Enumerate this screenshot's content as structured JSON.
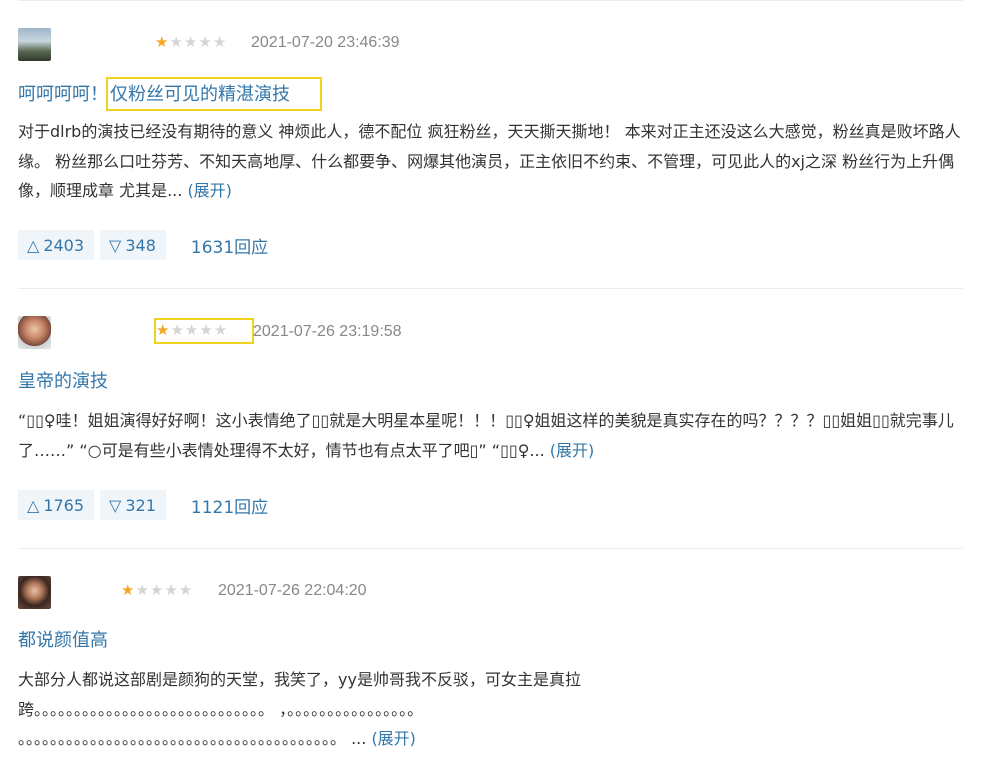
{
  "reviews": [
    {
      "rating": 1,
      "date": "2021-07-20 23:46:39",
      "title_plain": "呵呵呵呵！",
      "title_highlight": "仅粉丝可见的精湛演技",
      "body": "对于dlrb的演技已经没有期待的意义 神烦此人，德不配位 疯狂粉丝，天天撕天撕地！ 本来对正主还没这么大感觉，粉丝真是败坏路人缘。 粉丝那么口吐芬芳、不知天高地厚、什么都要争、网爆其他演员，正主依旧不约束、不管理，可见此人的xj之深 粉丝行为上升偶像，顺理成章 尤其是... ",
      "expand_label": "(展开)",
      "up_count": "2403",
      "down_count": "348",
      "reply_label": "1631回应"
    },
    {
      "rating": 1,
      "date": "2021-07-26 23:19:58",
      "title_plain": "皇帝的演技",
      "title_highlight": "",
      "body": "“▯▯♀哇！姐姐演得好好啊！这小表情绝了▯▯就是大明星本星呢！！！▯▯♀姐姐这样的美貌是真实存在的吗？？？？▯▯姐姐▯▯就完事儿了……” “○可是有些小表情处理得不太好，情节也有点太平了吧▯” “▯▯♀... ",
      "expand_label": "(展开)",
      "up_count": "1765",
      "down_count": "321",
      "reply_label": "1121回应"
    },
    {
      "rating": 1,
      "date": "2021-07-26 22:04:20",
      "title_plain": "都说颜值高",
      "title_highlight": "",
      "body_line1": "大部分人都说这部剧是颜狗的天堂，我笑了，yy是帅哥我不反驳，可女主是真拉",
      "body_line2": "跨。。。。。。。。。。。。。。。。。。。。。。。。。。。。。 ，。。。。。。。。。。。。。。。。",
      "body_line3": "。。。。。。。。。。。。。。。。。。。。。。。。。。。。。。。。。。。。。。。。 ... ",
      "expand_label": "(展开)"
    }
  ],
  "icons": {
    "up": "triangle-up-icon",
    "down": "triangle-down-icon",
    "star": "star-icon"
  },
  "colors": {
    "link": "#3377aa",
    "star_on": "#f5a623",
    "highlight_box": "#f0d31f",
    "vote_bg": "#f0f5fa"
  }
}
